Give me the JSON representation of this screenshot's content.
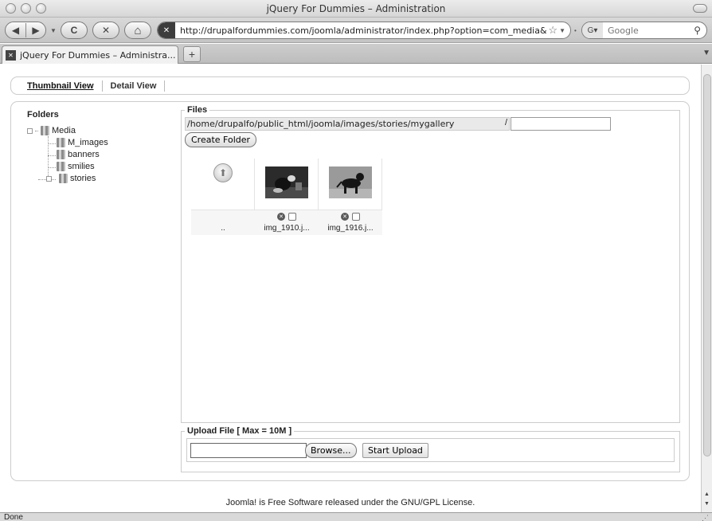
{
  "window": {
    "title": "jQuery For Dummies – Administration"
  },
  "toolbar": {
    "back_icon": "back-arrow-icon",
    "forward_icon": "forward-arrow-icon",
    "reload_glyph": "C",
    "stop_glyph": "✕",
    "home_glyph": "⌂",
    "url": "http://drupalfordummies.com/joomla/administrator/index.php?option=com_media&fo",
    "search_placeholder": "Google"
  },
  "tabs": [
    {
      "label": "jQuery For Dummies – Administra..."
    }
  ],
  "new_tab_glyph": "+",
  "view_switch": {
    "thumbnail": "Thumbnail View",
    "detail": "Detail View"
  },
  "folders": {
    "title": "Folders",
    "tree": [
      {
        "label": "Media",
        "level": 0
      },
      {
        "label": "M_images",
        "level": 1
      },
      {
        "label": "banners",
        "level": 1
      },
      {
        "label": "smilies",
        "level": 1
      },
      {
        "label": "stories",
        "level": 1
      }
    ]
  },
  "files": {
    "legend": "Files",
    "path": "/home/drupalfo/public_html/joomla/images/stories/mygallery",
    "path_separator": "/",
    "new_folder_value": "",
    "create_folder_label": "Create Folder",
    "items": [
      {
        "name": "..",
        "type": "up"
      },
      {
        "name": "img_1910.j...",
        "type": "image"
      },
      {
        "name": "img_1916.j...",
        "type": "image"
      }
    ]
  },
  "upload": {
    "legend": "Upload File [ Max = 10M ]",
    "file_value": "",
    "browse_label": "Browse...",
    "start_label": "Start Upload"
  },
  "footer": {
    "prefix": "Joomla! is Free Software released under the ",
    "link": "GNU/GPL License",
    "suffix": "."
  },
  "status": {
    "text": "Done"
  },
  "colors": {
    "chrome": "#d2d2d2",
    "panel_border": "#cccccc",
    "path_bg": "#e9e9e9"
  }
}
